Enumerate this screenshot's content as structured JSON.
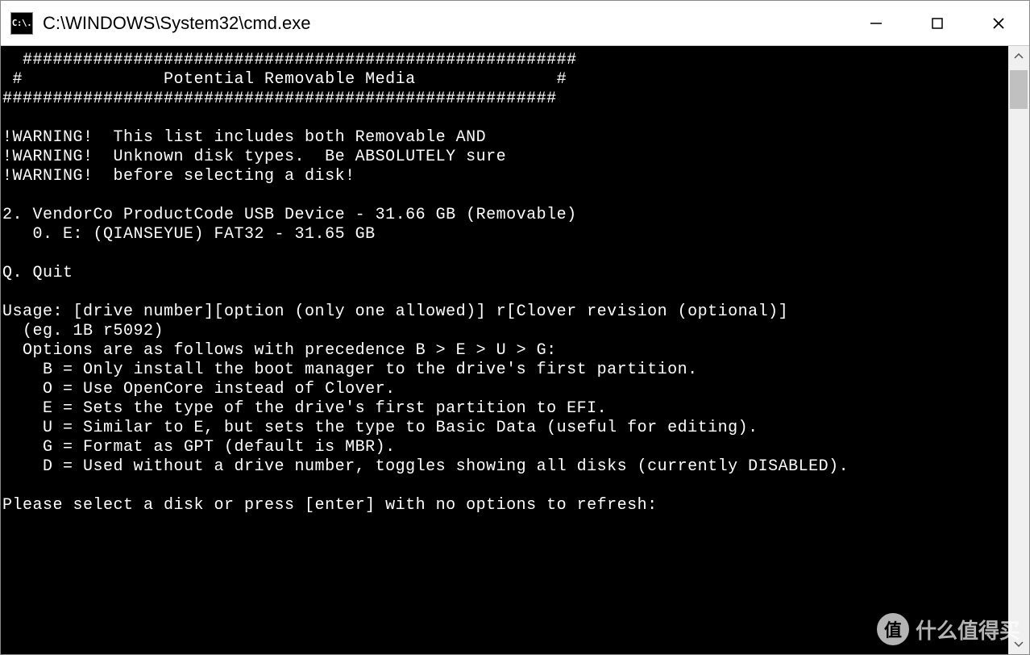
{
  "window": {
    "title": "C:\\WINDOWS\\System32\\cmd.exe",
    "icon_text": "C:\\."
  },
  "terminal": {
    "lines": [
      "  #######################################################",
      " #              Potential Removable Media              #",
      "#######################################################",
      "",
      "!WARNING!  This list includes both Removable AND",
      "!WARNING!  Unknown disk types.  Be ABSOLUTELY sure",
      "!WARNING!  before selecting a disk!",
      "",
      "2. VendorCo ProductCode USB Device - 31.66 GB (Removable)",
      "   0. E: (QIANSEYUE) FAT32 - 31.65 GB",
      "",
      "Q. Quit",
      "",
      "Usage: [drive number][option (only one allowed)] r[Clover revision (optional)]",
      "  (eg. 1B r5092)",
      "  Options are as follows with precedence B > E > U > G:",
      "    B = Only install the boot manager to the drive's first partition.",
      "    O = Use OpenCore instead of Clover.",
      "    E = Sets the type of the drive's first partition to EFI.",
      "    U = Similar to E, but sets the type to Basic Data (useful for editing).",
      "    G = Format as GPT (default is MBR).",
      "    D = Used without a drive number, toggles showing all disks (currently DISABLED).",
      "",
      "Please select a disk or press [enter] with no options to refresh:"
    ]
  },
  "watermark": {
    "badge": "值",
    "text": "什么值得买"
  }
}
